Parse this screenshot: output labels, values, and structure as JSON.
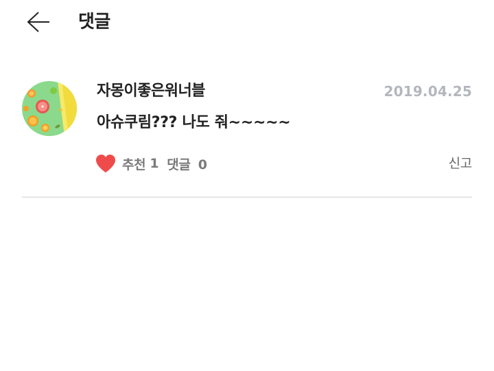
{
  "header": {
    "title": "댓글",
    "back_icon": "arrow-left-icon"
  },
  "comment": {
    "author": "자몽이좋은워너블",
    "date": "2019.04.25",
    "text": "아슈쿠림??? 나도 줘~~~~~",
    "avatar": "fruit-slices-image",
    "like_icon": "heart-icon",
    "like_color": "#ef4b4b",
    "recommend_label": "추천",
    "recommend_count": "1",
    "reply_label": "댓글",
    "reply_count": "0",
    "report_label": "신고"
  }
}
